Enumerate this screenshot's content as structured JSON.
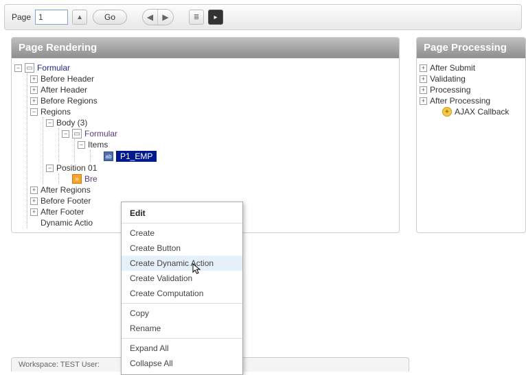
{
  "topbar": {
    "page_label": "Page",
    "page_value": "1",
    "go_label": "Go"
  },
  "panels": {
    "left_title": "Page Rendering",
    "right_title": "Page Processing"
  },
  "tree_left": {
    "root": "Formular",
    "before_header": "Before Header",
    "after_header": "After Header",
    "before_regions": "Before Regions",
    "regions": "Regions",
    "body": "Body (3)",
    "region_formular": "Formular",
    "items_label": "Items",
    "item_p1": "P1_EMP",
    "position01": "Position 01",
    "breadcrumb": "Bre",
    "after_regions": "After Regions",
    "before_footer": "Before Footer",
    "after_footer": "After Footer",
    "dynamic_actions": "Dynamic Actio"
  },
  "tree_right": {
    "after_submit": "After Submit",
    "validating": "Validating",
    "processing": "Processing",
    "after_processing": "After Processing",
    "ajax_callback": "AJAX Callback"
  },
  "ctx": {
    "edit": "Edit",
    "create": "Create",
    "create_button": "Create Button",
    "create_da": "Create Dynamic Action",
    "create_validation": "Create Validation",
    "create_computation": "Create Computation",
    "copy": "Copy",
    "rename": "Rename",
    "expand_all": "Expand All",
    "collapse_all": "Collapse All"
  },
  "status": "Workspace: TEST User:"
}
